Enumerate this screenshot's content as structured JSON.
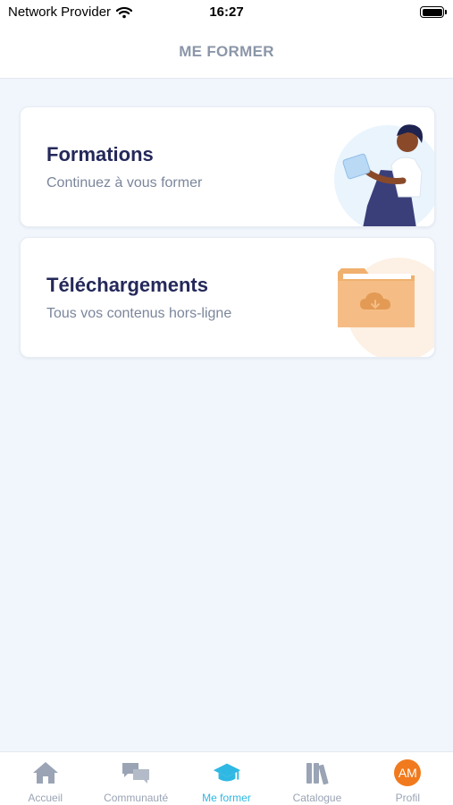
{
  "status_bar": {
    "carrier": "Network Provider",
    "time": "16:27"
  },
  "header": {
    "title": "ME FORMER"
  },
  "cards": [
    {
      "title": "Formations",
      "subtitle": "Continuez à vous former",
      "icon": "person-reading-tablet-illustration"
    },
    {
      "title": "Téléchargements",
      "subtitle": "Tous vos contenus hors-ligne",
      "icon": "folder-download-icon"
    }
  ],
  "tabs": [
    {
      "label": "Accueil",
      "icon": "home-icon",
      "active": false
    },
    {
      "label": "Communauté",
      "icon": "chat-bubbles-icon",
      "active": false
    },
    {
      "label": "Me former",
      "icon": "graduation-cap-icon",
      "active": true
    },
    {
      "label": "Catalogue",
      "icon": "books-icon",
      "active": false
    },
    {
      "label": "Profil",
      "icon": "avatar",
      "avatar_initials": "AM",
      "active": false
    }
  ],
  "colors": {
    "accent": "#2fb8e3",
    "background": "#f1f6fc",
    "title": "#24285a",
    "muted": "#8b96a8",
    "folder": "#f3b77c",
    "avatar": "#f07a1d"
  }
}
